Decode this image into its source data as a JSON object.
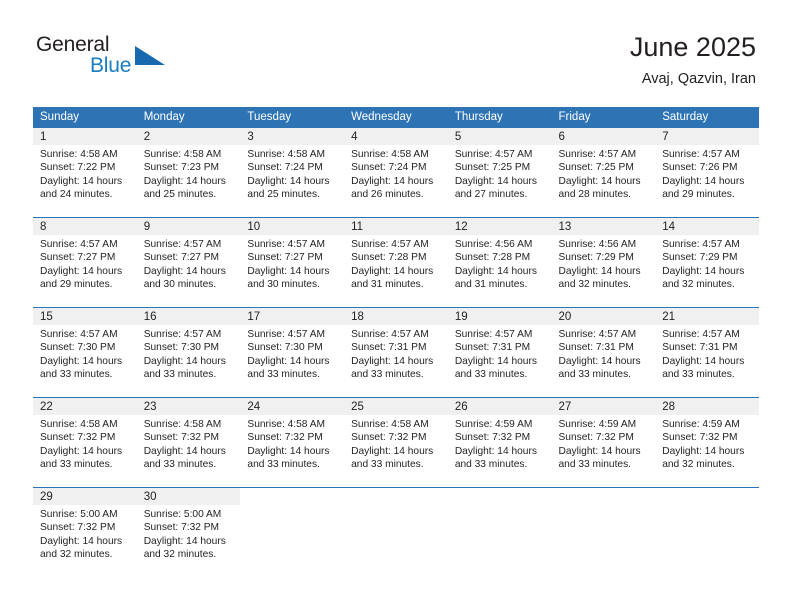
{
  "brand": {
    "name_part1": "General",
    "name_part2": "Blue",
    "triangle_icon": "triangle-logo-icon",
    "color": "#1769b0"
  },
  "header": {
    "title": "June 2025",
    "location": "Avaj, Qazvin, Iran"
  },
  "theme": {
    "header_bg": "#2e74b5",
    "daynum_bg": "#f0f0f0",
    "text": "#231f20"
  },
  "weekdays": [
    "Sunday",
    "Monday",
    "Tuesday",
    "Wednesday",
    "Thursday",
    "Friday",
    "Saturday"
  ],
  "weeks": [
    [
      {
        "day": "1",
        "sunrise": "Sunrise: 4:58 AM",
        "sunset": "Sunset: 7:22 PM",
        "daylight1": "Daylight: 14 hours",
        "daylight2": "and 24 minutes."
      },
      {
        "day": "2",
        "sunrise": "Sunrise: 4:58 AM",
        "sunset": "Sunset: 7:23 PM",
        "daylight1": "Daylight: 14 hours",
        "daylight2": "and 25 minutes."
      },
      {
        "day": "3",
        "sunrise": "Sunrise: 4:58 AM",
        "sunset": "Sunset: 7:24 PM",
        "daylight1": "Daylight: 14 hours",
        "daylight2": "and 25 minutes."
      },
      {
        "day": "4",
        "sunrise": "Sunrise: 4:58 AM",
        "sunset": "Sunset: 7:24 PM",
        "daylight1": "Daylight: 14 hours",
        "daylight2": "and 26 minutes."
      },
      {
        "day": "5",
        "sunrise": "Sunrise: 4:57 AM",
        "sunset": "Sunset: 7:25 PM",
        "daylight1": "Daylight: 14 hours",
        "daylight2": "and 27 minutes."
      },
      {
        "day": "6",
        "sunrise": "Sunrise: 4:57 AM",
        "sunset": "Sunset: 7:25 PM",
        "daylight1": "Daylight: 14 hours",
        "daylight2": "and 28 minutes."
      },
      {
        "day": "7",
        "sunrise": "Sunrise: 4:57 AM",
        "sunset": "Sunset: 7:26 PM",
        "daylight1": "Daylight: 14 hours",
        "daylight2": "and 29 minutes."
      }
    ],
    [
      {
        "day": "8",
        "sunrise": "Sunrise: 4:57 AM",
        "sunset": "Sunset: 7:27 PM",
        "daylight1": "Daylight: 14 hours",
        "daylight2": "and 29 minutes."
      },
      {
        "day": "9",
        "sunrise": "Sunrise: 4:57 AM",
        "sunset": "Sunset: 7:27 PM",
        "daylight1": "Daylight: 14 hours",
        "daylight2": "and 30 minutes."
      },
      {
        "day": "10",
        "sunrise": "Sunrise: 4:57 AM",
        "sunset": "Sunset: 7:27 PM",
        "daylight1": "Daylight: 14 hours",
        "daylight2": "and 30 minutes."
      },
      {
        "day": "11",
        "sunrise": "Sunrise: 4:57 AM",
        "sunset": "Sunset: 7:28 PM",
        "daylight1": "Daylight: 14 hours",
        "daylight2": "and 31 minutes."
      },
      {
        "day": "12",
        "sunrise": "Sunrise: 4:56 AM",
        "sunset": "Sunset: 7:28 PM",
        "daylight1": "Daylight: 14 hours",
        "daylight2": "and 31 minutes."
      },
      {
        "day": "13",
        "sunrise": "Sunrise: 4:56 AM",
        "sunset": "Sunset: 7:29 PM",
        "daylight1": "Daylight: 14 hours",
        "daylight2": "and 32 minutes."
      },
      {
        "day": "14",
        "sunrise": "Sunrise: 4:57 AM",
        "sunset": "Sunset: 7:29 PM",
        "daylight1": "Daylight: 14 hours",
        "daylight2": "and 32 minutes."
      }
    ],
    [
      {
        "day": "15",
        "sunrise": "Sunrise: 4:57 AM",
        "sunset": "Sunset: 7:30 PM",
        "daylight1": "Daylight: 14 hours",
        "daylight2": "and 33 minutes."
      },
      {
        "day": "16",
        "sunrise": "Sunrise: 4:57 AM",
        "sunset": "Sunset: 7:30 PM",
        "daylight1": "Daylight: 14 hours",
        "daylight2": "and 33 minutes."
      },
      {
        "day": "17",
        "sunrise": "Sunrise: 4:57 AM",
        "sunset": "Sunset: 7:30 PM",
        "daylight1": "Daylight: 14 hours",
        "daylight2": "and 33 minutes."
      },
      {
        "day": "18",
        "sunrise": "Sunrise: 4:57 AM",
        "sunset": "Sunset: 7:31 PM",
        "daylight1": "Daylight: 14 hours",
        "daylight2": "and 33 minutes."
      },
      {
        "day": "19",
        "sunrise": "Sunrise: 4:57 AM",
        "sunset": "Sunset: 7:31 PM",
        "daylight1": "Daylight: 14 hours",
        "daylight2": "and 33 minutes."
      },
      {
        "day": "20",
        "sunrise": "Sunrise: 4:57 AM",
        "sunset": "Sunset: 7:31 PM",
        "daylight1": "Daylight: 14 hours",
        "daylight2": "and 33 minutes."
      },
      {
        "day": "21",
        "sunrise": "Sunrise: 4:57 AM",
        "sunset": "Sunset: 7:31 PM",
        "daylight1": "Daylight: 14 hours",
        "daylight2": "and 33 minutes."
      }
    ],
    [
      {
        "day": "22",
        "sunrise": "Sunrise: 4:58 AM",
        "sunset": "Sunset: 7:32 PM",
        "daylight1": "Daylight: 14 hours",
        "daylight2": "and 33 minutes."
      },
      {
        "day": "23",
        "sunrise": "Sunrise: 4:58 AM",
        "sunset": "Sunset: 7:32 PM",
        "daylight1": "Daylight: 14 hours",
        "daylight2": "and 33 minutes."
      },
      {
        "day": "24",
        "sunrise": "Sunrise: 4:58 AM",
        "sunset": "Sunset: 7:32 PM",
        "daylight1": "Daylight: 14 hours",
        "daylight2": "and 33 minutes."
      },
      {
        "day": "25",
        "sunrise": "Sunrise: 4:58 AM",
        "sunset": "Sunset: 7:32 PM",
        "daylight1": "Daylight: 14 hours",
        "daylight2": "and 33 minutes."
      },
      {
        "day": "26",
        "sunrise": "Sunrise: 4:59 AM",
        "sunset": "Sunset: 7:32 PM",
        "daylight1": "Daylight: 14 hours",
        "daylight2": "and 33 minutes."
      },
      {
        "day": "27",
        "sunrise": "Sunrise: 4:59 AM",
        "sunset": "Sunset: 7:32 PM",
        "daylight1": "Daylight: 14 hours",
        "daylight2": "and 33 minutes."
      },
      {
        "day": "28",
        "sunrise": "Sunrise: 4:59 AM",
        "sunset": "Sunset: 7:32 PM",
        "daylight1": "Daylight: 14 hours",
        "daylight2": "and 32 minutes."
      }
    ],
    [
      {
        "day": "29",
        "sunrise": "Sunrise: 5:00 AM",
        "sunset": "Sunset: 7:32 PM",
        "daylight1": "Daylight: 14 hours",
        "daylight2": "and 32 minutes."
      },
      {
        "day": "30",
        "sunrise": "Sunrise: 5:00 AM",
        "sunset": "Sunset: 7:32 PM",
        "daylight1": "Daylight: 14 hours",
        "daylight2": "and 32 minutes."
      },
      null,
      null,
      null,
      null,
      null
    ]
  ]
}
